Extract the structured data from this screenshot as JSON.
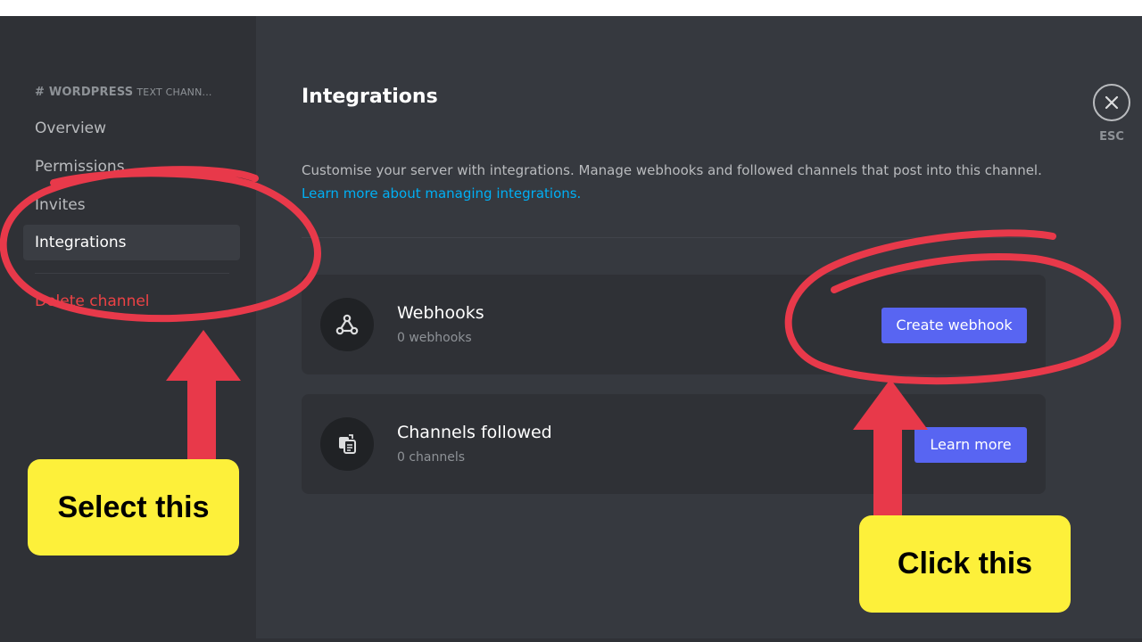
{
  "sidebar": {
    "channel_name": "# WORDPRESS",
    "channel_type": "TEXT CHANN...",
    "items": [
      {
        "label": "Overview"
      },
      {
        "label": "Permissions"
      },
      {
        "label": "Invites"
      },
      {
        "label": "Integrations",
        "selected": true
      }
    ],
    "delete_label": "Delete channel"
  },
  "main": {
    "title": "Integrations",
    "description": "Customise your server with integrations. Manage webhooks and followed channels that post into this channel.",
    "link": "Learn more about managing integrations.",
    "cards": [
      {
        "icon": "webhook-icon",
        "title": "Webhooks",
        "subtitle": "0 webhooks",
        "button": "Create webhook"
      },
      {
        "icon": "channels-followed-icon",
        "title": "Channels followed",
        "subtitle": "0 channels",
        "button": "Learn more"
      }
    ]
  },
  "close": {
    "label": "ESC",
    "icon": "close-icon"
  },
  "annotations": {
    "left_callout": "Select this",
    "right_callout": "Click this"
  },
  "colors": {
    "accent": "#5865f2",
    "danger": "#ed4245",
    "link": "#00aff4",
    "annotation_red": "#e8394a",
    "callout_yellow": "#fdf03a"
  }
}
